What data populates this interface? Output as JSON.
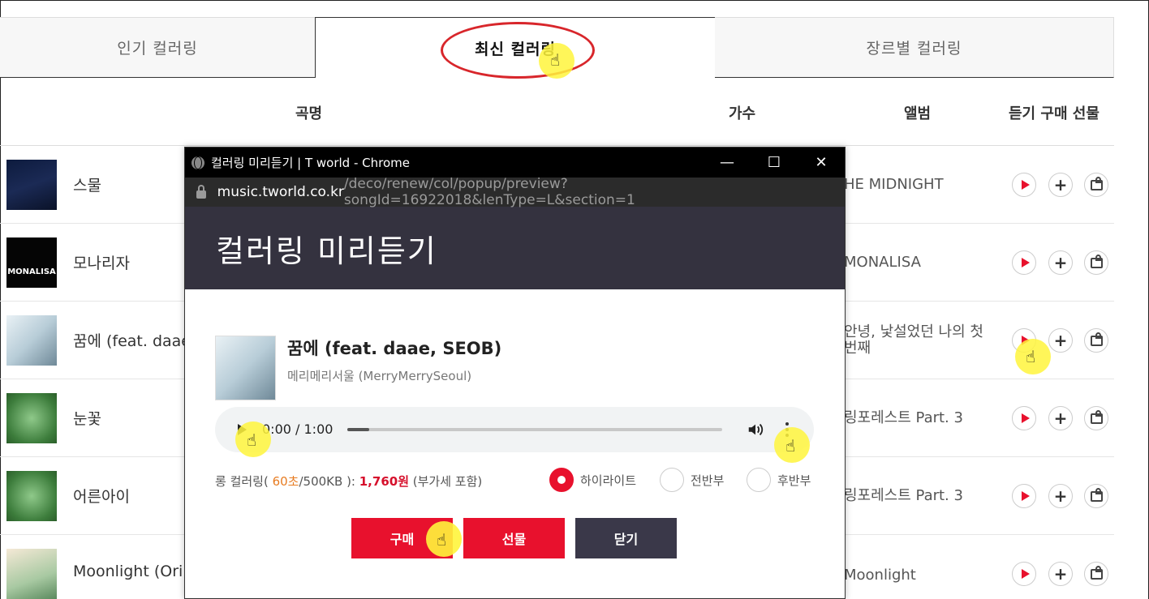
{
  "tabs": {
    "popular": "인기 컬러링",
    "new": "최신 컬러링",
    "genre": "장르별 컬러링"
  },
  "table_header": {
    "song": "곡명",
    "artist": "가수",
    "album": "앨범",
    "actions": "듣기 구매 선물"
  },
  "rows": [
    {
      "song": "스물",
      "album": "HE MIDNIGHT"
    },
    {
      "song": "모나리자",
      "album": "MONALISA",
      "thumb_text": "MONALISA"
    },
    {
      "song": "꿈에 (feat. daae",
      "album_line1": "안녕, 낯설었던 나의 첫",
      "album_line2": "번째"
    },
    {
      "song": "눈꽃",
      "album": "링포레스트 Part. 3"
    },
    {
      "song": "어른아이",
      "album": "링포레스트 Part. 3"
    },
    {
      "song": "Moonlight (Ori",
      "album": "Moonlight"
    }
  ],
  "popup": {
    "window_title": "컬러링 미리듣기 | T world - Chrome",
    "url_host": "music.tworld.co.kr",
    "url_path": "/deco/renew/col/popup/preview?songId=16922018&lenType=L&section=1",
    "heading": "컬러링 미리듣기",
    "song_title": "꿈에 (feat. daae, SEOB)",
    "artist": "메리메리서울 (MerryMerrySeoul)",
    "player_time": "0:00 / 1:00",
    "price_prefix": "롱 컬러링( ",
    "price_seconds": "60초",
    "price_size": "/500KB ): ",
    "price_won": "1,760원",
    "price_suffix": " (부가세 포함)",
    "radio_highlight": "하이라이트",
    "radio_first": "전반부",
    "radio_second": "후반부",
    "buy_label": "구매",
    "gift_label": "선물",
    "close_label": "닫기"
  }
}
